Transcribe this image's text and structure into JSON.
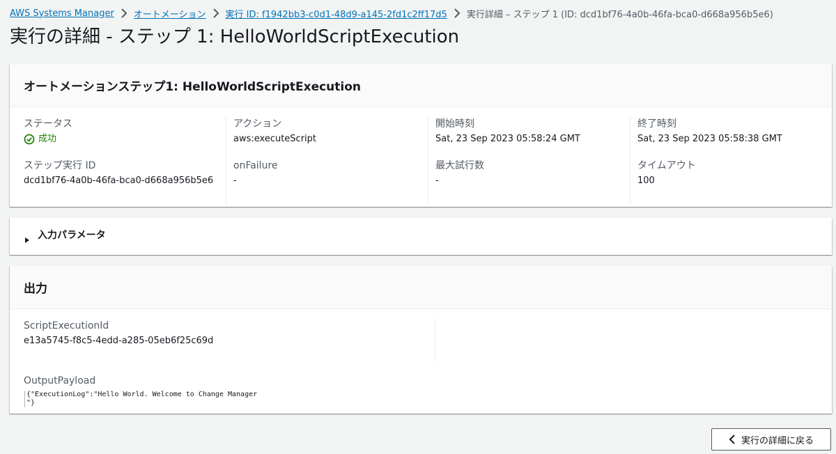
{
  "breadcrumb": {
    "items": [
      "AWS Systems Manager",
      "オートメーション",
      "実行 ID: f1942bb3-c0d1-48d9-a145-2fd1c2ff17d5"
    ],
    "current": "実行詳細 – ステップ 1 (ID: dcd1bf76-4a0b-46fa-bca0-d668a956b5e6)"
  },
  "page_title": "実行の詳細 - ステップ 1: HelloWorldScriptExecution",
  "step_panel": {
    "title": "オートメーションステップ1: HelloWorldScriptExecution",
    "status_label": "ステータス",
    "status_value": "成功",
    "step_exec_id_label": "ステップ実行 ID",
    "step_exec_id_value": "dcd1bf76-4a0b-46fa-bca0-d668a956b5e6",
    "action_label": "アクション",
    "action_value": "aws:executeScript",
    "on_failure_label": "onFailure",
    "on_failure_value": "-",
    "start_time_label": "開始時刻",
    "start_time_value": "Sat, 23 Sep 2023 05:58:24 GMT",
    "max_attempts_label": "最大試行数",
    "max_attempts_value": "-",
    "end_time_label": "終了時刻",
    "end_time_value": "Sat, 23 Sep 2023 05:58:38 GMT",
    "timeout_label": "タイムアウト",
    "timeout_value": "100"
  },
  "input_params": {
    "label": "入力パラメータ"
  },
  "output_panel": {
    "title": "出力",
    "script_exec_id_label": "ScriptExecutionId",
    "script_exec_id_value": "e13a5745-f8c5-4edd-a285-05eb6f25c69d",
    "payload_label": "OutputPayload",
    "payload_value": "{\"ExecutionLog\":\"Hello World. Welcome to Change Manager\n\"}"
  },
  "back_button": {
    "label": "実行の詳細に戻る"
  },
  "colors": {
    "link": "#0073bb",
    "success": "#1d8102",
    "background": "#f2f3f3"
  }
}
